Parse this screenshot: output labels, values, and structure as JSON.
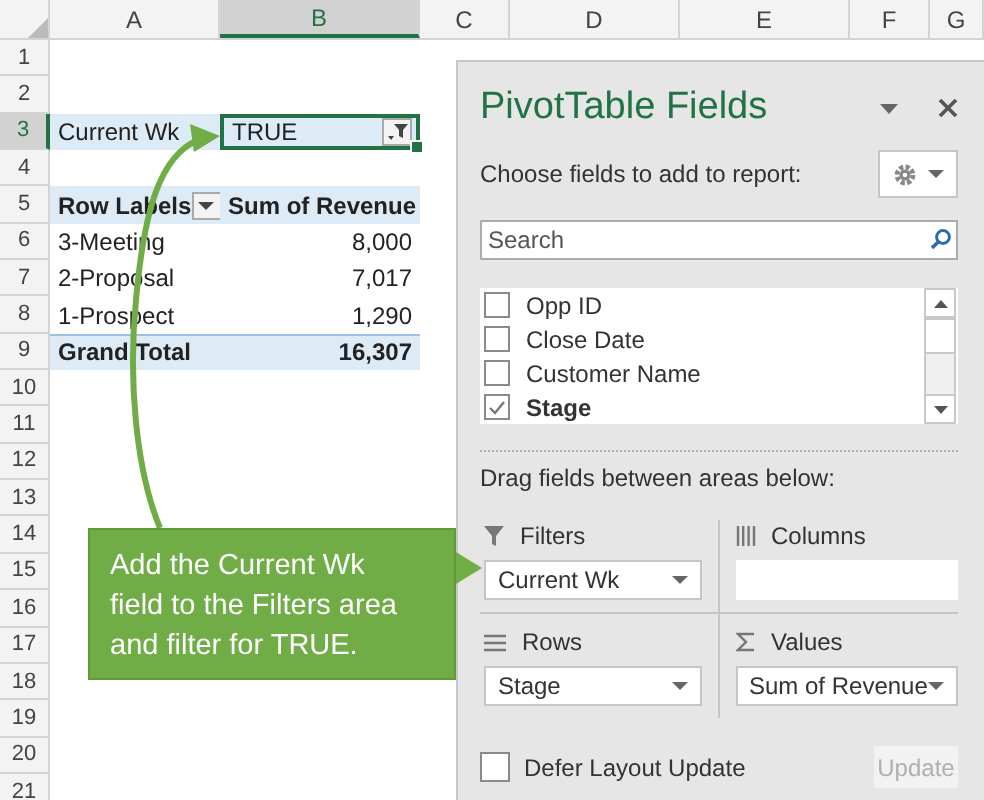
{
  "sheet": {
    "columns": [
      {
        "label": "A",
        "selected": false
      },
      {
        "label": "B",
        "selected": true
      },
      {
        "label": "C",
        "selected": false
      },
      {
        "label": "D",
        "selected": false
      },
      {
        "label": "E",
        "selected": false
      },
      {
        "label": "F",
        "selected": false
      },
      {
        "label": "G",
        "selected": false
      }
    ],
    "rows": [
      {
        "label": "1",
        "selected": false
      },
      {
        "label": "2",
        "selected": false
      },
      {
        "label": "3",
        "selected": true
      },
      {
        "label": "4",
        "selected": false
      },
      {
        "label": "5",
        "selected": false
      },
      {
        "label": "6",
        "selected": false
      },
      {
        "label": "7",
        "selected": false
      },
      {
        "label": "8",
        "selected": false
      },
      {
        "label": "9",
        "selected": false
      },
      {
        "label": "10",
        "selected": false
      },
      {
        "label": "11",
        "selected": false
      },
      {
        "label": "12",
        "selected": false
      },
      {
        "label": "13",
        "selected": false
      },
      {
        "label": "14",
        "selected": false
      },
      {
        "label": "15",
        "selected": false
      },
      {
        "label": "16",
        "selected": false
      },
      {
        "label": "17",
        "selected": false
      },
      {
        "label": "18",
        "selected": false
      },
      {
        "label": "19",
        "selected": false
      },
      {
        "label": "20",
        "selected": false
      },
      {
        "label": "21",
        "selected": false
      }
    ]
  },
  "report_filter": {
    "label": "Current Wk",
    "value": "TRUE"
  },
  "pivot": {
    "headers": [
      "Row Labels",
      "Sum of Revenue"
    ],
    "rows": [
      {
        "label": "3-Meeting",
        "value": "8,000"
      },
      {
        "label": "2-Proposal",
        "value": "7,017"
      },
      {
        "label": "1-Prospect",
        "value": "1,290"
      }
    ],
    "total": {
      "label": "Grand Total",
      "value": "16,307"
    }
  },
  "callout": {
    "text": "Add the Current Wk field to the Filters area and filter for TRUE."
  },
  "panel": {
    "title": "PivotTable Fields",
    "prompt": "Choose fields to add to report:",
    "search": {
      "placeholder": "Search"
    },
    "fields": [
      {
        "name": "Opp ID",
        "checked": false
      },
      {
        "name": "Close Date",
        "checked": false
      },
      {
        "name": "Customer Name",
        "checked": false
      },
      {
        "name": "Stage",
        "checked": true
      }
    ],
    "areas_hint": "Drag fields between areas below:",
    "areas": [
      {
        "kind": "filters",
        "label": "Filters",
        "items": [
          "Current Wk"
        ]
      },
      {
        "kind": "columns",
        "label": "Columns"
      },
      {
        "kind": "rows",
        "label": "Rows",
        "items": [
          "Stage"
        ]
      },
      {
        "kind": "values",
        "label": "Values",
        "items": [
          "Sum of Revenue"
        ]
      }
    ],
    "defer": {
      "label": "Defer Layout Update",
      "checked": false
    },
    "update_button": "Update"
  }
}
